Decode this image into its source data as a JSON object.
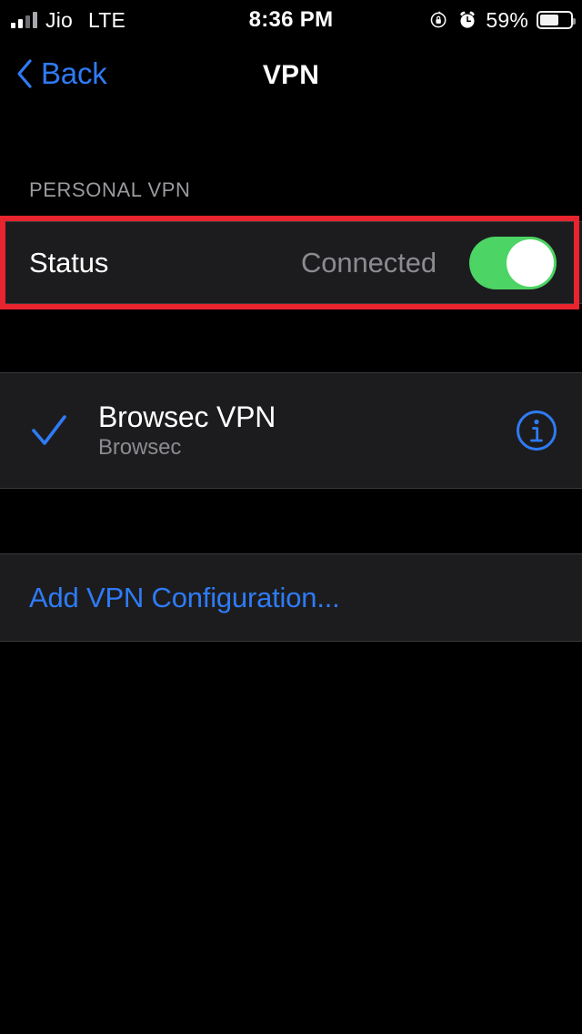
{
  "status_bar": {
    "carrier": "Jio",
    "radio_type": "LTE",
    "time": "8:36 PM",
    "battery_percent": "59%",
    "signal_bars_filled": 2,
    "signal_bars_total": 4,
    "icons": {
      "rotation_lock": "rotation-lock-icon",
      "alarm": "alarm-clock-icon",
      "battery": "battery-icon"
    }
  },
  "nav": {
    "back_label": "Back",
    "title": "VPN"
  },
  "sections": {
    "personal_vpn_header": "PERSONAL VPN"
  },
  "status_row": {
    "label": "Status",
    "value": "Connected",
    "toggle_on": true
  },
  "vpn_config": {
    "title": "Browsec VPN",
    "subtitle": "Browsec",
    "selected": true,
    "info_label": "i"
  },
  "add_vpn": {
    "label": "Add VPN Configuration..."
  },
  "colors": {
    "background": "#000000",
    "card": "#1c1c1e",
    "accent_blue": "#2f7bf6",
    "toggle_green": "#4cd464",
    "secondary_text": "#8b8b90",
    "annotation_red": "#e8242e"
  }
}
